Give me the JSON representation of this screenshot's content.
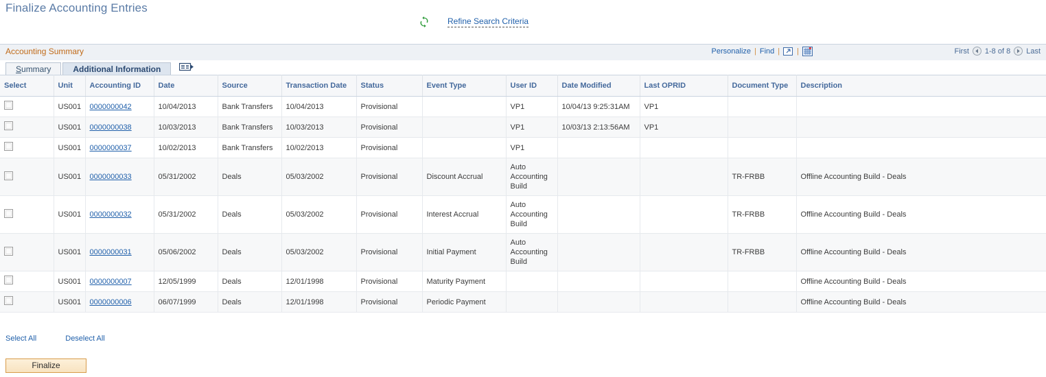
{
  "page": {
    "title": "Finalize Accounting Entries"
  },
  "refine": {
    "icon": "refresh-icon",
    "link_label": "Refine Search Criteria"
  },
  "grid": {
    "title": "Accounting Summary",
    "actions": {
      "personalize": "Personalize",
      "find": "Find",
      "separator": "|",
      "view_all_icon": "expand-grid-icon",
      "download_icon": "download-spreadsheet-icon"
    },
    "nav": {
      "first": "First",
      "prev_icon": "previous-arrow-icon",
      "range": "1-8 of 8",
      "next_icon": "next-arrow-icon",
      "last": "Last"
    },
    "tabs": [
      {
        "label": "Summary",
        "accesskey": "S",
        "rest": "ummary",
        "active": false
      },
      {
        "label": "Additional Information",
        "active": true
      }
    ],
    "tab_expand_icon": "show-all-columns-icon",
    "columns": [
      "Select",
      "Unit",
      "Accounting ID",
      "Date",
      "Source",
      "Transaction Date",
      "Status",
      "Event Type",
      "User ID",
      "Date Modified",
      "Last OPRID",
      "Document Type",
      "Description"
    ],
    "rows": [
      {
        "select": false,
        "unit": "US001",
        "accounting_id": "0000000042",
        "date": "10/04/2013",
        "source": "Bank Transfers",
        "transaction_date": "10/04/2013",
        "status": "Provisional",
        "event_type": "",
        "user_id": "VP1",
        "date_modified": "10/04/13  9:25:31AM",
        "last_oprid": "VP1",
        "document_type": "",
        "description": ""
      },
      {
        "select": false,
        "unit": "US001",
        "accounting_id": "0000000038",
        "date": "10/03/2013",
        "source": "Bank Transfers",
        "transaction_date": "10/03/2013",
        "status": "Provisional",
        "event_type": "",
        "user_id": "VP1",
        "date_modified": "10/03/13  2:13:56AM",
        "last_oprid": "VP1",
        "document_type": "",
        "description": ""
      },
      {
        "select": false,
        "unit": "US001",
        "accounting_id": "0000000037",
        "date": "10/02/2013",
        "source": "Bank Transfers",
        "transaction_date": "10/02/2013",
        "status": "Provisional",
        "event_type": "",
        "user_id": "VP1",
        "date_modified": "",
        "last_oprid": "",
        "document_type": "",
        "description": ""
      },
      {
        "select": false,
        "unit": "US001",
        "accounting_id": "0000000033",
        "date": "05/31/2002",
        "source": "Deals",
        "transaction_date": "05/03/2002",
        "status": "Provisional",
        "event_type": "Discount Accrual",
        "user_id": "Auto Accounting Build",
        "date_modified": "",
        "last_oprid": "",
        "document_type": "TR-FRBB",
        "description": "Offline Accounting Build - Deals"
      },
      {
        "select": false,
        "unit": "US001",
        "accounting_id": "0000000032",
        "date": "05/31/2002",
        "source": "Deals",
        "transaction_date": "05/03/2002",
        "status": "Provisional",
        "event_type": "Interest Accrual",
        "user_id": "Auto Accounting Build",
        "date_modified": "",
        "last_oprid": "",
        "document_type": "TR-FRBB",
        "description": "Offline Accounting Build - Deals"
      },
      {
        "select": false,
        "unit": "US001",
        "accounting_id": "0000000031",
        "date": "05/06/2002",
        "source": "Deals",
        "transaction_date": "05/03/2002",
        "status": "Provisional",
        "event_type": "Initial Payment",
        "user_id": "Auto Accounting Build",
        "date_modified": "",
        "last_oprid": "",
        "document_type": "TR-FRBB",
        "description": "Offline Accounting Build - Deals"
      },
      {
        "select": false,
        "unit": "US001",
        "accounting_id": "0000000007",
        "date": "12/05/1999",
        "source": "Deals",
        "transaction_date": "12/01/1998",
        "status": "Provisional",
        "event_type": "Maturity Payment",
        "user_id": "",
        "date_modified": "",
        "last_oprid": "",
        "document_type": "",
        "description": "Offline Accounting Build  - Deals"
      },
      {
        "select": false,
        "unit": "US001",
        "accounting_id": "0000000006",
        "date": "06/07/1999",
        "source": "Deals",
        "transaction_date": "12/01/1998",
        "status": "Provisional",
        "event_type": "Periodic Payment",
        "user_id": "",
        "date_modified": "",
        "last_oprid": "",
        "document_type": "",
        "description": "Offline Accounting Build  - Deals"
      }
    ]
  },
  "footer": {
    "select_all": "Select All",
    "deselect_all": "Deselect All",
    "finalize_button": "Finalize"
  },
  "colors": {
    "page_title": "#5a7ba6",
    "grid_title": "#c06a18",
    "link": "#1f5faa",
    "header_text": "#44699c",
    "button_border": "#d79b4a"
  }
}
